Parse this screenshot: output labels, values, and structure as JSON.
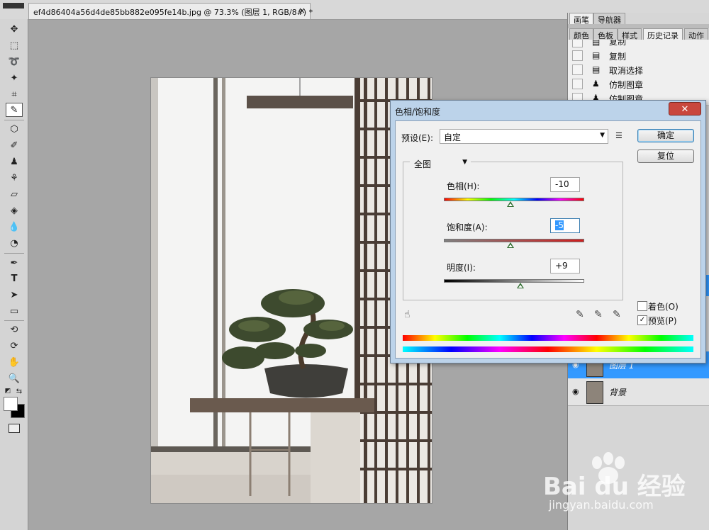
{
  "document": {
    "tab_title": "ef4d86404a56d4de85bb882e095fe14b.jpg @ 73.3% (图层 1, RGB/8#) *",
    "close_glyph": "×"
  },
  "panels": {
    "top_tabs": [
      "画笔",
      "导航器"
    ],
    "tabs": [
      "颜色",
      "色板",
      "样式",
      "历史记录",
      "动作"
    ],
    "history": [
      {
        "label": "复制",
        "icon": "document-icon"
      },
      {
        "label": "复制",
        "icon": "document-icon"
      },
      {
        "label": "取消选择",
        "icon": "document-icon"
      },
      {
        "label": "仿制图章",
        "icon": "stamp-icon"
      },
      {
        "label": "仿制图章",
        "icon": "stamp-icon"
      }
    ],
    "layers": [
      {
        "name": "图层 1",
        "selected": true
      },
      {
        "name": "背景",
        "selected": false
      }
    ]
  },
  "dialog": {
    "title": "色相/饱和度",
    "close_glyph": "✕",
    "preset_label": "预设(E):",
    "preset_value": "自定",
    "channel_value": "全图",
    "ok_label": "确定",
    "reset_label": "复位",
    "hue": {
      "label": "色相(H):",
      "value": "-10",
      "level": -10,
      "range": [
        -180,
        180
      ]
    },
    "saturation": {
      "label": "饱和度(A):",
      "value": "-5",
      "level": -5,
      "range": [
        -100,
        100
      ]
    },
    "lightness": {
      "label": "明度(I):",
      "value": "+9",
      "level": 9,
      "range": [
        -100,
        100
      ]
    },
    "colorize_label": "着色(O)",
    "colorize_checked": false,
    "preview_label": "预览(P)",
    "preview_checked": true,
    "check_glyph": "✓"
  },
  "watermark": {
    "brand": "Bai du 经验",
    "url": "jingyan.baidu.com"
  },
  "colors": {
    "dialog_frame": "#bcd3ea",
    "close_button": "#c9473d",
    "layer_selected": "#3399ff"
  }
}
